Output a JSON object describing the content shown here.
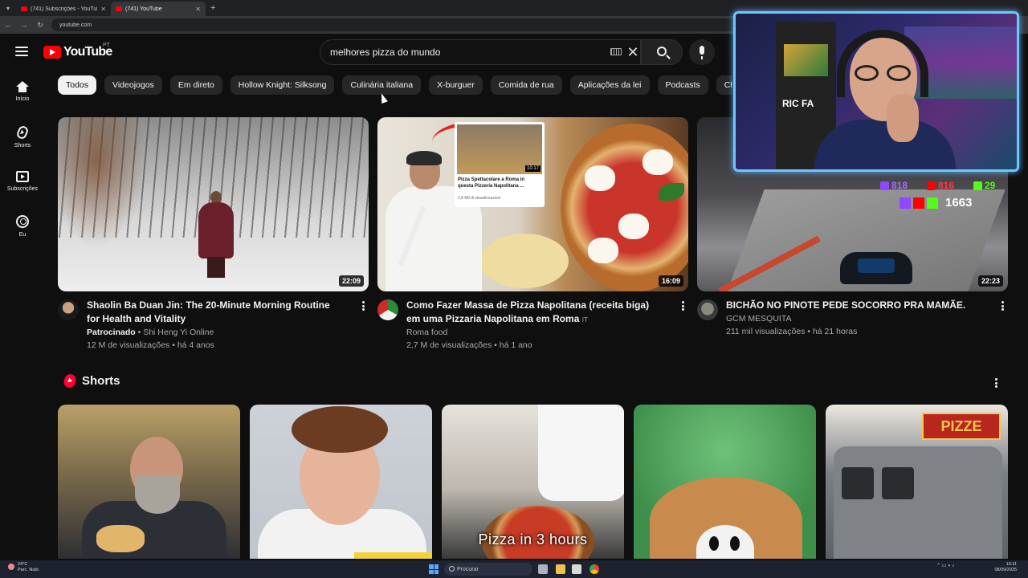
{
  "browser": {
    "tabs": [
      {
        "title": "(741) Subscrições - YouTube",
        "active": false
      },
      {
        "title": "(741) YouTube",
        "active": true
      }
    ],
    "url": "youtube.com"
  },
  "masthead": {
    "logo_text": "YouTube",
    "country_code": "PT",
    "search_value": "melhores pizza do mundo"
  },
  "guide": {
    "items": [
      {
        "label": "Início",
        "icon": "home-icon"
      },
      {
        "label": "Shorts",
        "icon": "shorts-icon"
      },
      {
        "label": "Subscrições",
        "icon": "subscriptions-icon"
      },
      {
        "label": "Eu",
        "icon": "you-icon"
      }
    ]
  },
  "chips": [
    {
      "label": "Todos",
      "active": true
    },
    {
      "label": "Videojogos"
    },
    {
      "label": "Em direto"
    },
    {
      "label": "Hollow Knight: Silksong"
    },
    {
      "label": "Culinária italiana"
    },
    {
      "label": "X-burguer"
    },
    {
      "label": "Comida de rua"
    },
    {
      "label": "Aplicações da lei"
    },
    {
      "label": "Podcasts"
    },
    {
      "label": "Churras"
    }
  ],
  "videos": [
    {
      "title": "Shaolin Ba Duan Jin: The 20-Minute Morning Routine for Health and Vitality",
      "sponsored": "Patrocinado",
      "channel": "Shi Heng Yi Online",
      "stats": "12 M de visualizações • há 4 anos",
      "duration": "22:09"
    },
    {
      "title": "Como Fazer Massa de Pizza Napolitana (receita biga) em uma Pizzaria Napolitana em Roma",
      "lang_badge": "IT",
      "channel": "Roma food",
      "stats": "2,7 M de visualizações • há 1 ano",
      "duration": "16:09",
      "inset": {
        "duration": "10:17",
        "title": "Pizza Spettacolare a Roma in questa Pizzeria Napolitana ...",
        "views": "2,8 Mil di visualizzazioni"
      }
    },
    {
      "title": "BICHÃO NO PINOTE PEDE SOCORRO PRA MAMÃE.",
      "channel": "GCM MESQUITA",
      "stats": "211 mil visualizações • há 21 horas",
      "duration": "22:23"
    }
  ],
  "shorts": {
    "title": "Shorts",
    "items": [
      {
        "overlay": ""
      },
      {
        "overlay": ""
      },
      {
        "overlay": "Pizza in 3 hours"
      },
      {
        "overlay": ""
      },
      {
        "overlay": "",
        "sign": "PIZZE"
      }
    ]
  },
  "stream_overlay": {
    "arcade_logo": "RIC FA",
    "twitch_count": "818",
    "youtube_count": "816",
    "kick_count": "29",
    "total": "1663"
  },
  "taskbar": {
    "weather_temp": "24°C",
    "weather_desc": "Parc. Nubl.",
    "search_placeholder": "Procurar",
    "time": "16:11",
    "date": "08/09/2025"
  },
  "colors": {
    "accent": "#ff0000",
    "background": "#0f0f0f",
    "chip_bg": "#272727",
    "overlay_border": "#6ec6ff"
  }
}
